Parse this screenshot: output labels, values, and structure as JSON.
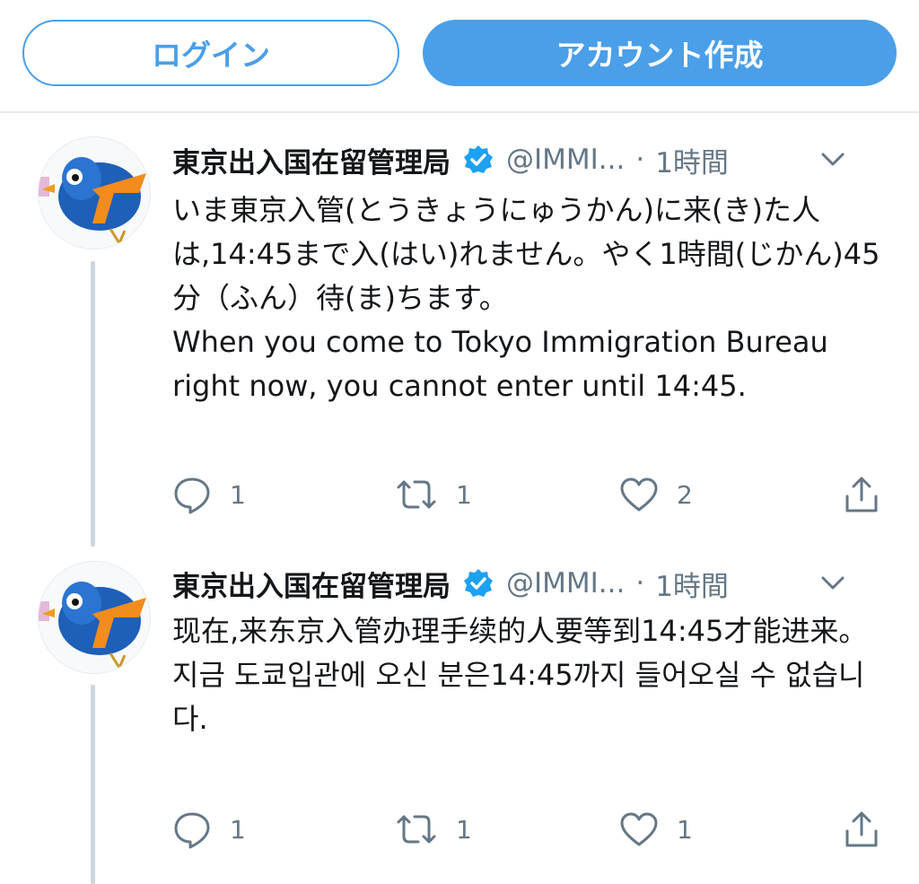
{
  "buttons": {
    "login": "ログイン",
    "signup": "アカウント作成"
  },
  "colors": {
    "accent": "#4a9fe8",
    "secondary_text": "#657786",
    "primary_text": "#14171a",
    "divider": "#e6ecf0",
    "verified": "#1da1f2"
  },
  "tweets": [
    {
      "display_name": "東京出入国在留管理局",
      "verified": true,
      "handle": "@IMMI...",
      "separator": "·",
      "time": "1時間",
      "lines": [
        "いま東京入管(とうきょうにゅうかん)に来(き)た人は,14:45まで入(はい)れません。やく1時間(じかん)45分（ふん）待(ま)ちます。",
        "When you come to Tokyo Immigration Bureau right now, you cannot enter until 14:45."
      ],
      "counts": {
        "reply": "1",
        "retweet": "1",
        "like": "2"
      }
    },
    {
      "display_name": "東京出入国在留管理局",
      "verified": true,
      "handle": "@IMMI...",
      "separator": "·",
      "time": "1時間",
      "lines": [
        "现在,来东京入管办理手续的人要等到14:45才能进来。",
        "지금 도쿄입관에 오신 분은14:45까지 들어오실 수 없습니다."
      ],
      "counts": {
        "reply": "1",
        "retweet": "1",
        "like": "1"
      }
    }
  ],
  "icons": {
    "avatar": "blue-bird-mascot-avatar",
    "verified": "verified-badge-icon",
    "caret": "chevron-down-icon",
    "reply": "reply-icon",
    "retweet": "retweet-icon",
    "like": "heart-icon",
    "share": "share-icon"
  }
}
